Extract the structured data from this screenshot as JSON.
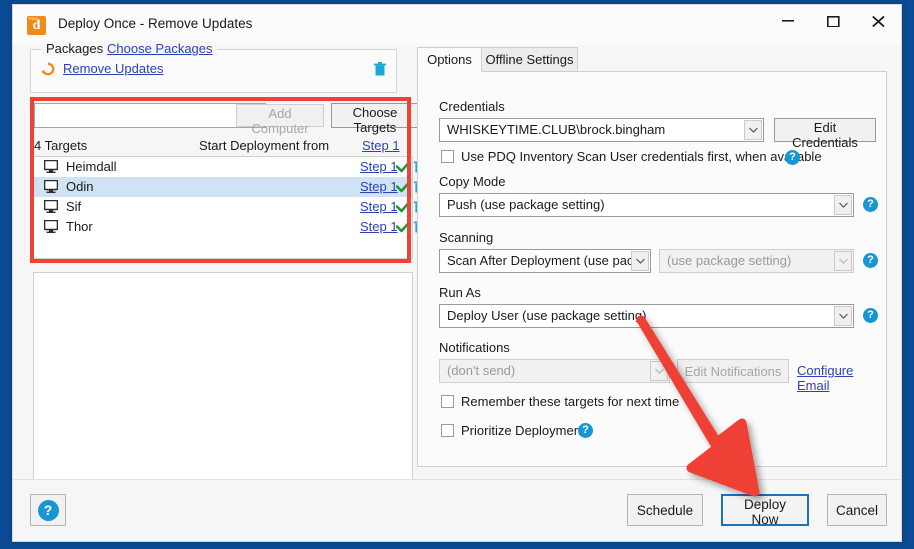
{
  "window": {
    "title": "Deploy Once - Remove Updates",
    "app_icon": "pdq-deploy-icon",
    "controls": {
      "minimize": "minimize-icon",
      "maximize": "maximize-icon",
      "close": "close-icon"
    }
  },
  "left": {
    "packages_group": {
      "label": "Packages",
      "choose_link": "Choose Packages",
      "package_name": "Remove Updates",
      "package_icon": "update-package-icon",
      "delete_icon": "trash-icon"
    },
    "add_computer": {
      "input_value": "",
      "input_placeholder": "",
      "add_button": "Add Computer",
      "choose_targets_button": "Choose Targets"
    },
    "targets_header": {
      "count_label": "4 Targets",
      "start_from_label": "Start Deployment from",
      "start_from_step": "Step 1"
    },
    "targets": [
      {
        "name": "Heimdall",
        "step": "Step 1",
        "selected": false
      },
      {
        "name": "Odin",
        "step": "Step 1",
        "selected": true
      },
      {
        "name": "Sif",
        "step": "Step 1",
        "selected": false
      },
      {
        "name": "Thor",
        "step": "Step 1",
        "selected": false
      }
    ]
  },
  "right": {
    "tabs": [
      {
        "label": "Options",
        "active": true
      },
      {
        "label": "Offline Settings",
        "active": false
      }
    ],
    "credentials": {
      "label": "Credentials",
      "value": "WHISKEYTIME.CLUB\\brock.bingham",
      "edit_button": "Edit Credentials",
      "checkbox_label": "Use PDQ Inventory Scan User credentials first, when available",
      "checkbox_checked": false,
      "help": "?"
    },
    "copy_mode": {
      "label": "Copy Mode",
      "value": "Push (use package setting)",
      "help": "?"
    },
    "scanning": {
      "label": "Scanning",
      "value": "Scan After Deployment (use pac...",
      "secondary_value": "(use package setting)",
      "help": "?"
    },
    "run_as": {
      "label": "Run As",
      "value": "Deploy User (use package setting)",
      "help": "?"
    },
    "notifications": {
      "label": "Notifications",
      "value": "(don't send)",
      "edit_button": "Edit Notifications",
      "configure_link": "Configure Email"
    },
    "remember_targets": {
      "label": "Remember these targets for next time",
      "checked": false
    },
    "prioritize": {
      "label": "Prioritize Deployment",
      "checked": false,
      "help": "?"
    }
  },
  "footer": {
    "help_button": "?",
    "schedule_button": "Schedule",
    "deploy_now_button": "Deploy Now",
    "cancel_button": "Cancel"
  },
  "annotations": {
    "highlight_color": "#ef4136",
    "arrow_color": "#ef4136"
  }
}
